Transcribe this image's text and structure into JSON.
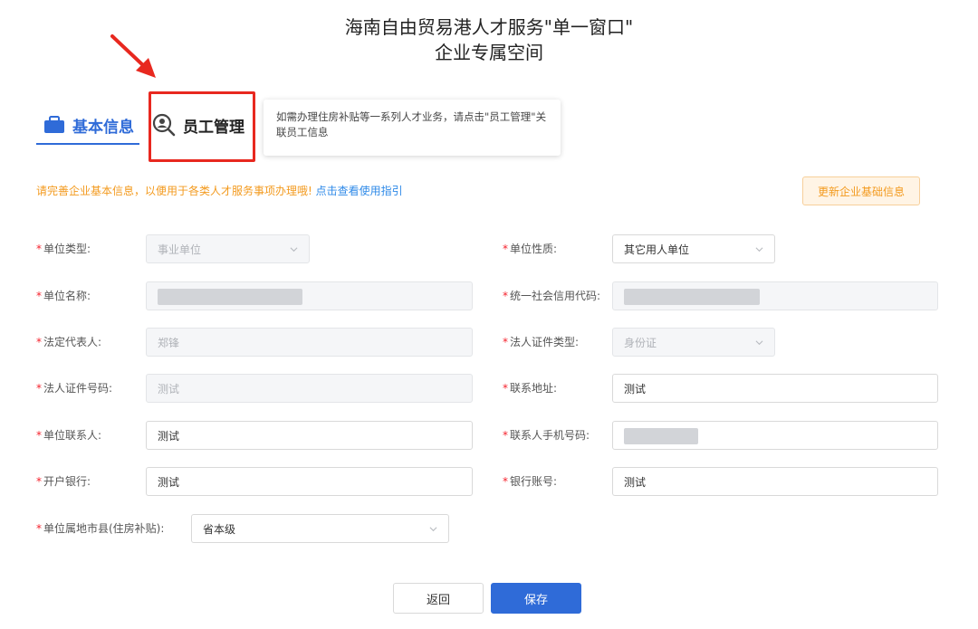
{
  "header": {
    "title_line1": "海南自由贸易港人才服务\"单一窗口\"",
    "title_line2": "企业专属空间"
  },
  "tabs": {
    "basic_info": "基本信息",
    "employee_mgmt": "员工管理"
  },
  "tooltip": {
    "text": "如需办理住房补贴等一系列人才业务，请点击\"员工管理\"关联员工信息"
  },
  "notice": {
    "text": "请完善企业基本信息，以便用于各类人才服务事项办理哦!",
    "link": "点击查看使用指引"
  },
  "update_button": "更新企业基础信息",
  "form": {
    "unit_type": {
      "label": "单位类型:",
      "value": "事业单位"
    },
    "unit_nature": {
      "label": "单位性质:",
      "value": "其它用人单位"
    },
    "unit_name": {
      "label": "单位名称:",
      "value": ""
    },
    "credit_code": {
      "label": "统一社会信用代码:",
      "value": ""
    },
    "legal_rep": {
      "label": "法定代表人:",
      "value": "郑锋"
    },
    "legal_id_type": {
      "label": "法人证件类型:",
      "value": "身份证"
    },
    "legal_id_no": {
      "label": "法人证件号码:",
      "value": "测试"
    },
    "address": {
      "label": "联系地址:",
      "value": "测试"
    },
    "contact": {
      "label": "单位联系人:",
      "value": "测试"
    },
    "contact_phone": {
      "label": "联系人手机号码:",
      "value": ""
    },
    "bank": {
      "label": "开户银行:",
      "value": "测试"
    },
    "account": {
      "label": "银行账号:",
      "value": "测试"
    },
    "county": {
      "label": "单位属地市县(住房补贴):",
      "value": "省本级"
    }
  },
  "buttons": {
    "back": "返回",
    "save": "保存"
  },
  "colors": {
    "primary": "#2f6bd8",
    "warning": "#f39a1e",
    "highlight_red": "#e8281f"
  }
}
